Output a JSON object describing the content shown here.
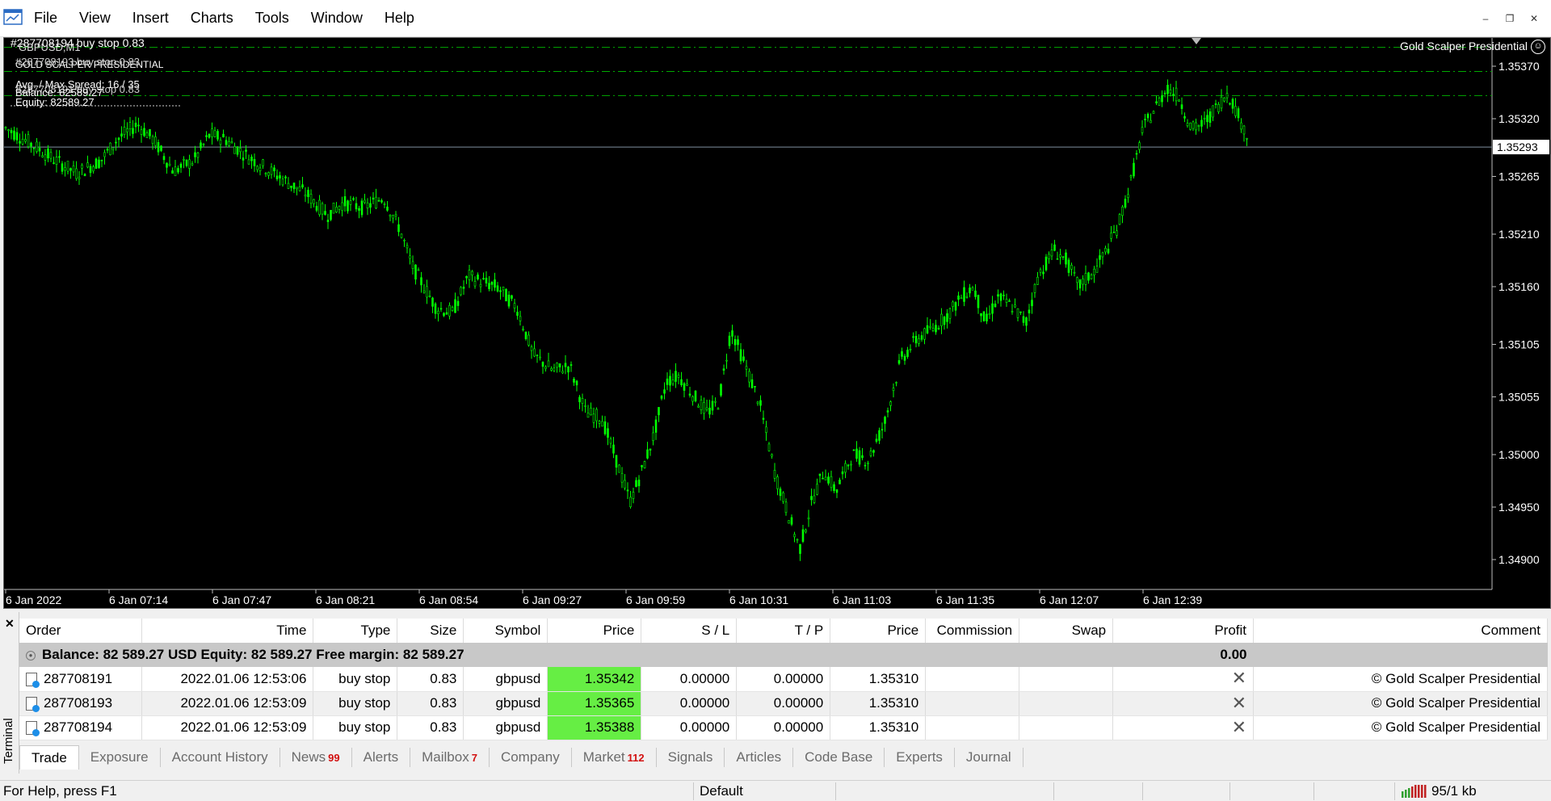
{
  "menu": [
    "File",
    "View",
    "Insert",
    "Charts",
    "Tools",
    "Window",
    "Help"
  ],
  "chart": {
    "symbol_line": "GBPUSD,M1",
    "ea_title": "GOLD SCALPER PRESIDENTIAL",
    "order_lines": [
      "#287708194 buy stop 0.83",
      "#287708193 buy stop 0.83",
      "#287708191 buy stop 0.83"
    ],
    "spread": "Avg. / Max Spread:  16 / 35",
    "balance": "Balance:  82589.27",
    "equity": "Equity:  82589.27",
    "ea_name": "Gold Scalper Presidential",
    "current_price": "1.35293",
    "price_ticks": [
      "1.35370",
      "1.35320",
      "1.35265",
      "1.35210",
      "1.35160",
      "1.35105",
      "1.35055",
      "1.35000",
      "1.34950",
      "1.34900"
    ],
    "time_ticks": [
      "6 Jan 2022",
      "6 Jan 07:14",
      "6 Jan 07:47",
      "6 Jan 08:21",
      "6 Jan 08:54",
      "6 Jan 09:27",
      "6 Jan 09:59",
      "6 Jan 10:31",
      "6 Jan 11:03",
      "6 Jan 11:35",
      "6 Jan 12:07",
      "6 Jan 12:39"
    ],
    "colors": {
      "bull": "#00ff00",
      "bear": "#00ff00",
      "background": "#000000",
      "order_line": "#00aa00"
    }
  },
  "terminal": {
    "label": "Terminal",
    "columns": [
      "Order",
      "Time",
      "Type",
      "Size",
      "Symbol",
      "Price",
      "S / L",
      "T / P",
      "Price",
      "Commission",
      "Swap",
      "Profit",
      "Comment"
    ],
    "summary": {
      "text": "Balance: 82 589.27 USD  Equity: 82 589.27  Free margin: 82 589.27",
      "profit": "0.00"
    },
    "rows": [
      {
        "order": "287708191",
        "time": "2022.01.06 12:53:06",
        "type": "buy stop",
        "size": "0.83",
        "symbol": "gbpusd",
        "price": "1.35342",
        "sl": "0.00000",
        "tp": "0.00000",
        "cur_price": "1.35310",
        "comment": "© Gold Scalper Presidential"
      },
      {
        "order": "287708193",
        "time": "2022.01.06 12:53:09",
        "type": "buy stop",
        "size": "0.83",
        "symbol": "gbpusd",
        "price": "1.35365",
        "sl": "0.00000",
        "tp": "0.00000",
        "cur_price": "1.35310",
        "comment": "© Gold Scalper Presidential"
      },
      {
        "order": "287708194",
        "time": "2022.01.06 12:53:09",
        "type": "buy stop",
        "size": "0.83",
        "symbol": "gbpusd",
        "price": "1.35388",
        "sl": "0.00000",
        "tp": "0.00000",
        "cur_price": "1.35310",
        "comment": "© Gold Scalper Presidential"
      }
    ],
    "tabs": [
      {
        "label": "Trade",
        "badge": ""
      },
      {
        "label": "Exposure",
        "badge": ""
      },
      {
        "label": "Account History",
        "badge": ""
      },
      {
        "label": "News",
        "badge": "99"
      },
      {
        "label": "Alerts",
        "badge": ""
      },
      {
        "label": "Mailbox",
        "badge": "7"
      },
      {
        "label": "Company",
        "badge": ""
      },
      {
        "label": "Market",
        "badge": "112"
      },
      {
        "label": "Signals",
        "badge": ""
      },
      {
        "label": "Articles",
        "badge": ""
      },
      {
        "label": "Code Base",
        "badge": ""
      },
      {
        "label": "Experts",
        "badge": ""
      },
      {
        "label": "Journal",
        "badge": ""
      }
    ]
  },
  "status": {
    "help": "For Help, press F1",
    "profile": "Default",
    "traffic": "95/1 kb"
  }
}
